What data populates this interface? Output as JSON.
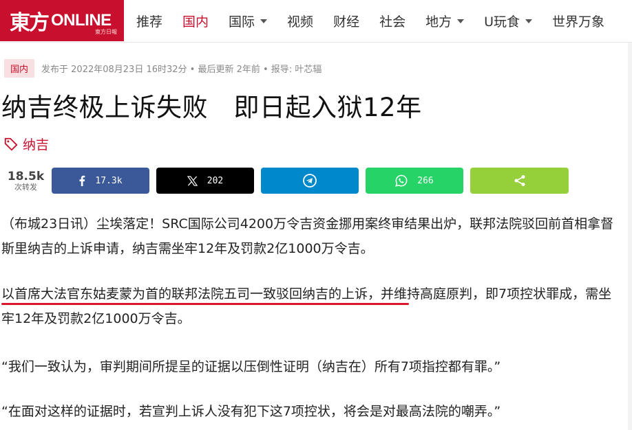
{
  "logo": {
    "mark": "東方",
    "word": "ONLINE",
    "sub": "東方日報"
  },
  "nav": [
    {
      "label": "推荐",
      "dropdown": false,
      "active": false
    },
    {
      "label": "国内",
      "dropdown": false,
      "active": true
    },
    {
      "label": "国际",
      "dropdown": true,
      "active": false
    },
    {
      "label": "视频",
      "dropdown": false,
      "active": false
    },
    {
      "label": "财经",
      "dropdown": false,
      "active": false
    },
    {
      "label": "社会",
      "dropdown": false,
      "active": false
    },
    {
      "label": "地方",
      "dropdown": true,
      "active": false
    },
    {
      "label": "U玩食",
      "dropdown": true,
      "active": false
    },
    {
      "label": "世界万象",
      "dropdown": false,
      "active": false
    }
  ],
  "article": {
    "category": "国内",
    "meta": "发布于 2022年08月23日 16时32分 • 最后更新 2年前 • 报导: 叶芯辐",
    "title": "纳吉终极上诉失败　即日起入狱12年",
    "tag": "纳吉",
    "share": {
      "total": "18.5k",
      "total_label": "次转发",
      "facebook": "17.3k",
      "twitter": "202",
      "whatsapp": "266"
    },
    "paragraphs": [
      "（布城23日讯）尘埃落定！SRC国际公司4200万令吉资金挪用案终审结果出炉，联邦法院驳回前首相拿督斯里纳吉的上诉申请，纳吉需坐牢12年及罚款2亿1000万令吉。",
      "以首席大法官东姑麦蒙为首的联邦法院五司一致驳回纳吉的上诉，并维持高庭原判，即7项控状罪成，需坐牢12年及罚款2亿1000万令吉。",
      "“我们一致认为，审判期间所提呈的证据以压倒性证明（纳吉在）所有7项指控都有罪。”",
      "“在面对这样的证据时，若宣判上诉人没有犯下这7项控状，将会是对最高法院的嘲弄。”"
    ]
  },
  "colors": {
    "brand": "#c8102e",
    "facebook": "#3b5998",
    "twitter": "#000000",
    "telegram": "#0088cc",
    "whatsapp": "#25d366",
    "share": "#95d03a"
  },
  "icons": [
    "facebook-icon",
    "x-icon",
    "telegram-icon",
    "whatsapp-icon",
    "share-icon",
    "tag-icon",
    "chevron-down-icon"
  ]
}
